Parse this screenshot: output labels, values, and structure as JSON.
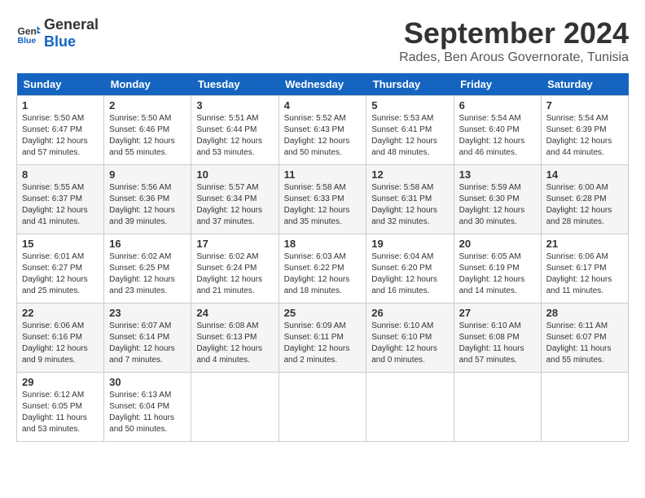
{
  "header": {
    "logo_line1": "General",
    "logo_line2": "Blue",
    "month_year": "September 2024",
    "location": "Rades, Ben Arous Governorate, Tunisia"
  },
  "days_of_week": [
    "Sunday",
    "Monday",
    "Tuesday",
    "Wednesday",
    "Thursday",
    "Friday",
    "Saturday"
  ],
  "weeks": [
    [
      {
        "day": "1",
        "sunrise": "5:50 AM",
        "sunset": "6:47 PM",
        "daylight": "12 hours and 57 minutes."
      },
      {
        "day": "2",
        "sunrise": "5:50 AM",
        "sunset": "6:46 PM",
        "daylight": "12 hours and 55 minutes."
      },
      {
        "day": "3",
        "sunrise": "5:51 AM",
        "sunset": "6:44 PM",
        "daylight": "12 hours and 53 minutes."
      },
      {
        "day": "4",
        "sunrise": "5:52 AM",
        "sunset": "6:43 PM",
        "daylight": "12 hours and 50 minutes."
      },
      {
        "day": "5",
        "sunrise": "5:53 AM",
        "sunset": "6:41 PM",
        "daylight": "12 hours and 48 minutes."
      },
      {
        "day": "6",
        "sunrise": "5:54 AM",
        "sunset": "6:40 PM",
        "daylight": "12 hours and 46 minutes."
      },
      {
        "day": "7",
        "sunrise": "5:54 AM",
        "sunset": "6:39 PM",
        "daylight": "12 hours and 44 minutes."
      }
    ],
    [
      {
        "day": "8",
        "sunrise": "5:55 AM",
        "sunset": "6:37 PM",
        "daylight": "12 hours and 41 minutes."
      },
      {
        "day": "9",
        "sunrise": "5:56 AM",
        "sunset": "6:36 PM",
        "daylight": "12 hours and 39 minutes."
      },
      {
        "day": "10",
        "sunrise": "5:57 AM",
        "sunset": "6:34 PM",
        "daylight": "12 hours and 37 minutes."
      },
      {
        "day": "11",
        "sunrise": "5:58 AM",
        "sunset": "6:33 PM",
        "daylight": "12 hours and 35 minutes."
      },
      {
        "day": "12",
        "sunrise": "5:58 AM",
        "sunset": "6:31 PM",
        "daylight": "12 hours and 32 minutes."
      },
      {
        "day": "13",
        "sunrise": "5:59 AM",
        "sunset": "6:30 PM",
        "daylight": "12 hours and 30 minutes."
      },
      {
        "day": "14",
        "sunrise": "6:00 AM",
        "sunset": "6:28 PM",
        "daylight": "12 hours and 28 minutes."
      }
    ],
    [
      {
        "day": "15",
        "sunrise": "6:01 AM",
        "sunset": "6:27 PM",
        "daylight": "12 hours and 25 minutes."
      },
      {
        "day": "16",
        "sunrise": "6:02 AM",
        "sunset": "6:25 PM",
        "daylight": "12 hours and 23 minutes."
      },
      {
        "day": "17",
        "sunrise": "6:02 AM",
        "sunset": "6:24 PM",
        "daylight": "12 hours and 21 minutes."
      },
      {
        "day": "18",
        "sunrise": "6:03 AM",
        "sunset": "6:22 PM",
        "daylight": "12 hours and 18 minutes."
      },
      {
        "day": "19",
        "sunrise": "6:04 AM",
        "sunset": "6:20 PM",
        "daylight": "12 hours and 16 minutes."
      },
      {
        "day": "20",
        "sunrise": "6:05 AM",
        "sunset": "6:19 PM",
        "daylight": "12 hours and 14 minutes."
      },
      {
        "day": "21",
        "sunrise": "6:06 AM",
        "sunset": "6:17 PM",
        "daylight": "12 hours and 11 minutes."
      }
    ],
    [
      {
        "day": "22",
        "sunrise": "6:06 AM",
        "sunset": "6:16 PM",
        "daylight": "12 hours and 9 minutes."
      },
      {
        "day": "23",
        "sunrise": "6:07 AM",
        "sunset": "6:14 PM",
        "daylight": "12 hours and 7 minutes."
      },
      {
        "day": "24",
        "sunrise": "6:08 AM",
        "sunset": "6:13 PM",
        "daylight": "12 hours and 4 minutes."
      },
      {
        "day": "25",
        "sunrise": "6:09 AM",
        "sunset": "6:11 PM",
        "daylight": "12 hours and 2 minutes."
      },
      {
        "day": "26",
        "sunrise": "6:10 AM",
        "sunset": "6:10 PM",
        "daylight": "12 hours and 0 minutes."
      },
      {
        "day": "27",
        "sunrise": "6:10 AM",
        "sunset": "6:08 PM",
        "daylight": "11 hours and 57 minutes."
      },
      {
        "day": "28",
        "sunrise": "6:11 AM",
        "sunset": "6:07 PM",
        "daylight": "11 hours and 55 minutes."
      }
    ],
    [
      {
        "day": "29",
        "sunrise": "6:12 AM",
        "sunset": "6:05 PM",
        "daylight": "11 hours and 53 minutes."
      },
      {
        "day": "30",
        "sunrise": "6:13 AM",
        "sunset": "6:04 PM",
        "daylight": "11 hours and 50 minutes."
      },
      null,
      null,
      null,
      null,
      null
    ]
  ]
}
